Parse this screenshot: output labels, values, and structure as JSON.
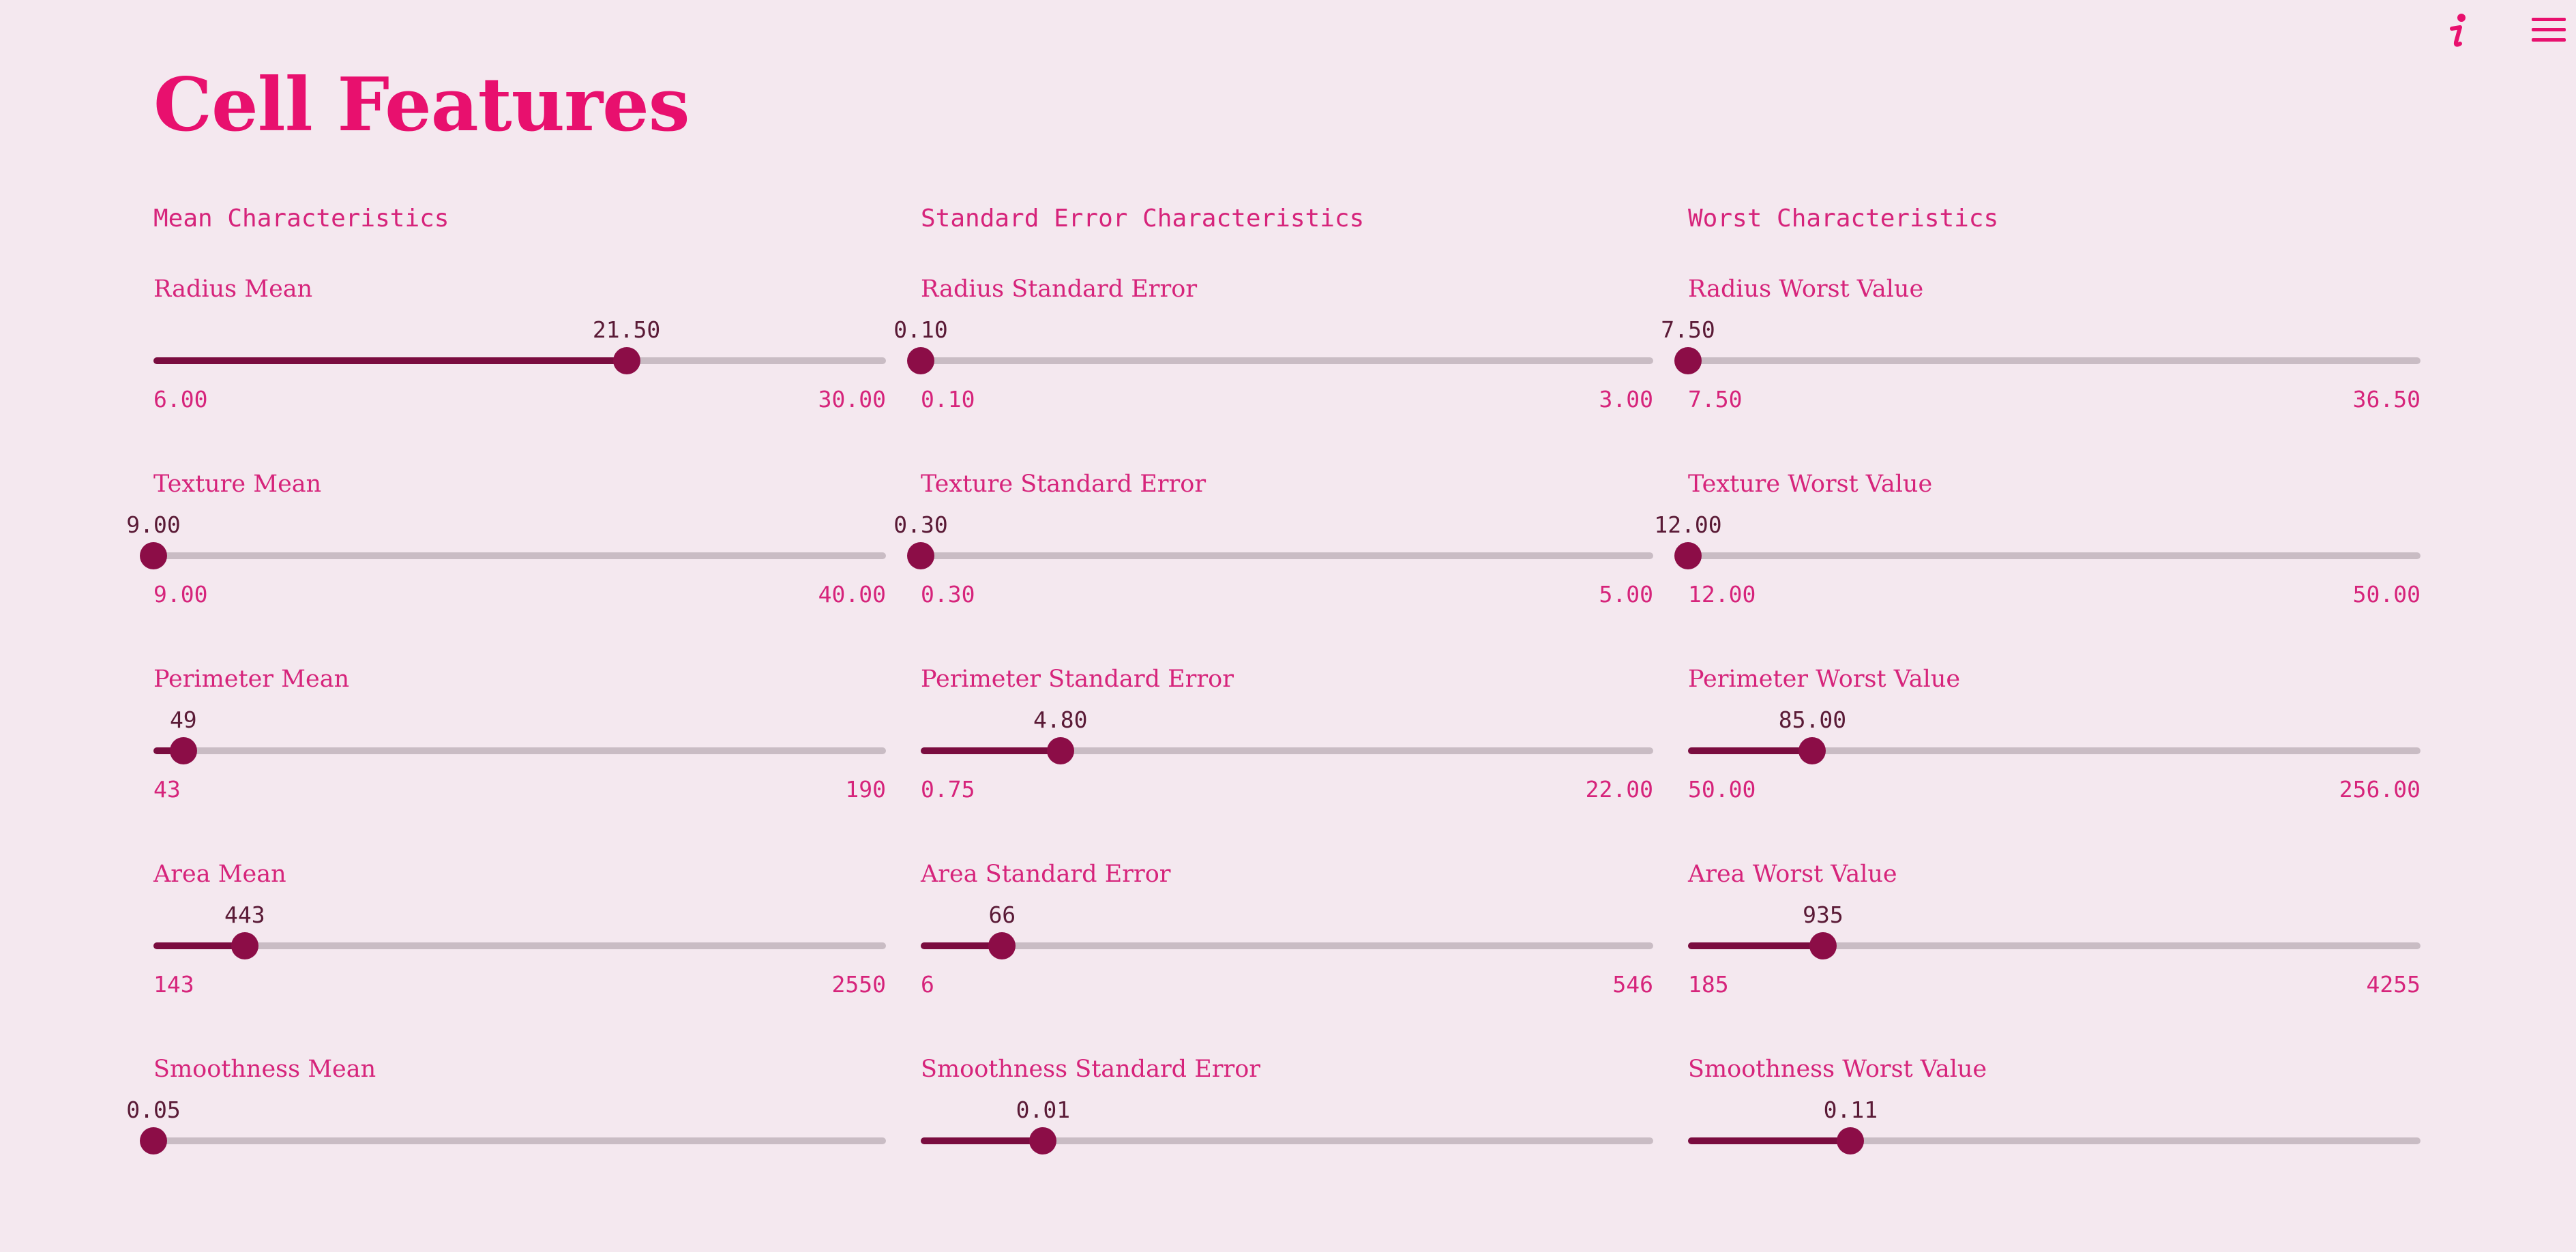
{
  "page_title": "Cell Features",
  "toolbar": {
    "info_icon": "info-icon",
    "menu_icon": "hamburger-menu-icon"
  },
  "colors": {
    "accent": "#e8106e",
    "background": "#f4e8ef",
    "slider_fill": "#7a0c3f",
    "slider_thumb": "#8c0d47",
    "slider_track": "#c9bcc4"
  },
  "columns": [
    {
      "heading": "Mean Characteristics",
      "sliders": [
        {
          "label": "Radius Mean",
          "value": "21.50",
          "min": "6.00",
          "max": "30.00",
          "fraction": 0.6458
        },
        {
          "label": "Texture Mean",
          "value": "9.00",
          "min": "9.00",
          "max": "40.00",
          "fraction": 0.0
        },
        {
          "label": "Perimeter Mean",
          "value": "49",
          "min": "43",
          "max": "190",
          "fraction": 0.0408
        },
        {
          "label": "Area Mean",
          "value": "443",
          "min": "143",
          "max": "2550",
          "fraction": 0.1246
        },
        {
          "label": "Smoothness Mean",
          "value": "0.05",
          "min": "",
          "max": "",
          "fraction": 0.0
        }
      ]
    },
    {
      "heading": "Standard Error Characteristics",
      "sliders": [
        {
          "label": "Radius Standard Error",
          "value": "0.10",
          "min": "0.10",
          "max": "3.00",
          "fraction": 0.0
        },
        {
          "label": "Texture Standard Error",
          "value": "0.30",
          "min": "0.30",
          "max": "5.00",
          "fraction": 0.0
        },
        {
          "label": "Perimeter Standard Error",
          "value": "4.80",
          "min": "0.75",
          "max": "22.00",
          "fraction": 0.1906
        },
        {
          "label": "Area Standard Error",
          "value": "66",
          "min": "6",
          "max": "546",
          "fraction": 0.1111
        },
        {
          "label": "Smoothness Standard Error",
          "value": "0.01",
          "min": "",
          "max": "",
          "fraction": 0.167
        }
      ]
    },
    {
      "heading": "Worst Characteristics",
      "sliders": [
        {
          "label": "Radius Worst Value",
          "value": "7.50",
          "min": "7.50",
          "max": "36.50",
          "fraction": 0.0
        },
        {
          "label": "Texture Worst Value",
          "value": "12.00",
          "min": "12.00",
          "max": "50.00",
          "fraction": 0.0
        },
        {
          "label": "Perimeter Worst Value",
          "value": "85.00",
          "min": "50.00",
          "max": "256.00",
          "fraction": 0.1699
        },
        {
          "label": "Area Worst Value",
          "value": "935",
          "min": "185",
          "max": "4255",
          "fraction": 0.1843
        },
        {
          "label": "Smoothness Worst Value",
          "value": "0.11",
          "min": "",
          "max": "",
          "fraction": 0.222
        }
      ]
    }
  ]
}
